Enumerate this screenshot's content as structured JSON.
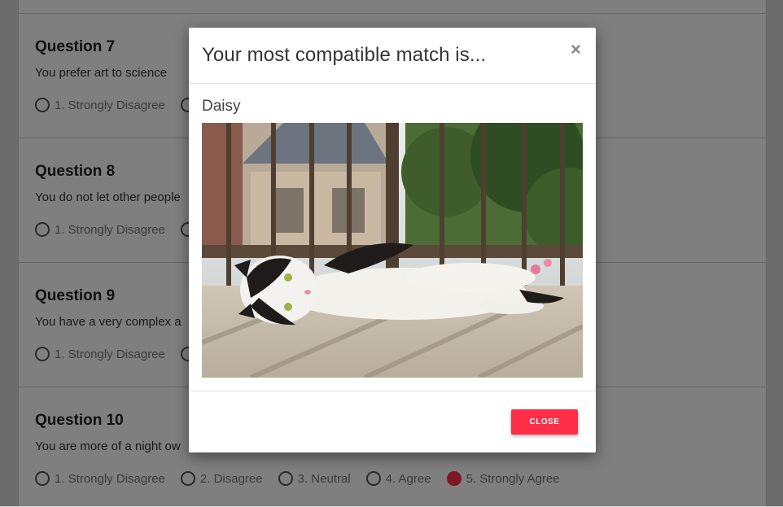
{
  "questions": [
    {
      "title": "Question 7",
      "text": "You prefer art to science",
      "selected": null
    },
    {
      "title": "Question 8",
      "text": "You do not let other people",
      "selected": null
    },
    {
      "title": "Question 9",
      "text": "You have a very complex a",
      "selected": null
    },
    {
      "title": "Question 10",
      "text": "You are more of a night ow",
      "selected": 5
    }
  ],
  "options": [
    "1. Strongly Disagree",
    "2. Disagree",
    "3. Neutral",
    "4. Agree",
    "5. Strongly Agree"
  ],
  "modal": {
    "title": "Your most compatible match is...",
    "close_symbol": "×",
    "match_name": "Daisy",
    "close_label": "CLOSE"
  },
  "colors": {
    "accent": "#ff2d48",
    "overlay": "rgba(0,0,0,0.5)"
  }
}
